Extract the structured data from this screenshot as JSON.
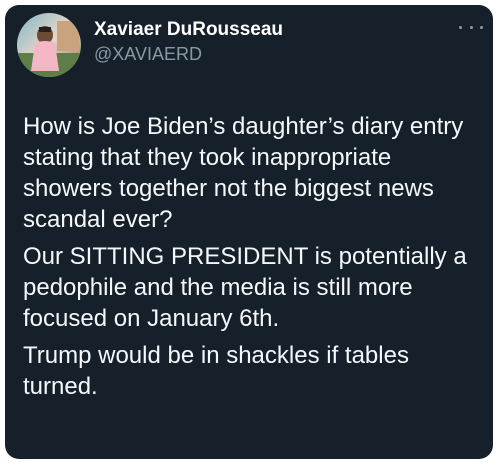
{
  "tweet": {
    "author": {
      "display_name": "Xaviaer DuRousseau",
      "handle": "@XAVIAERD"
    },
    "menu_icon": "more-horizontal-icon",
    "paragraphs": [
      "How is Joe Biden’s daughter’s diary entry stating that they took inappropriate showers together not the biggest news scandal ever?",
      "Our SITTING PRESIDENT is potentially a pedophile and the media is still more focused on January 6th.",
      "Trump would be in shackles if tables turned."
    ]
  },
  "colors": {
    "card_background": "#15202b",
    "text_primary": "#f5f8fa",
    "text_secondary": "#8899a6",
    "page_background": "#ffffff"
  }
}
